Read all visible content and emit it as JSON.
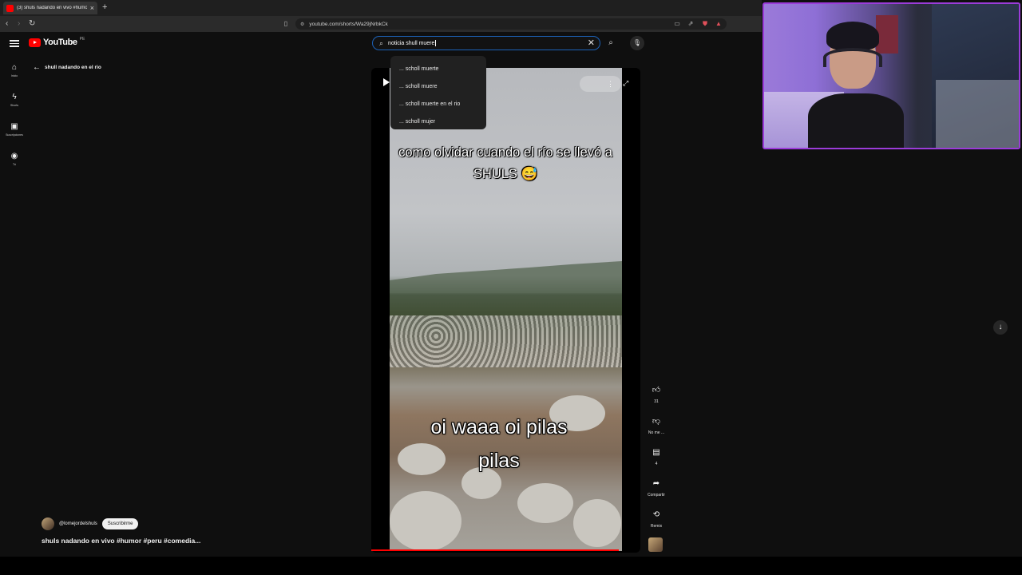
{
  "browser": {
    "tab_title": "(3) shuls nadando en vivo #humo",
    "url": "youtube.com/shorts/Wa29jNrbkCk"
  },
  "youtube": {
    "logo_text": "YouTube",
    "logo_country": "PE",
    "search": {
      "value": "noticia shull muere",
      "suggestions": [
        "... scholl muerte",
        "... scholl muere",
        "... scholl muerte en el rio",
        "... scholl mujer"
      ]
    },
    "rail": [
      {
        "icon": "home-icon",
        "label": "Inicio"
      },
      {
        "icon": "shorts-icon",
        "label": "Shorts"
      },
      {
        "icon": "subscriptions-icon",
        "label": "Suscripciones"
      },
      {
        "icon": "you-icon",
        "label": "Tú"
      }
    ],
    "back_title": "shull nadando en el rio",
    "video": {
      "caption_top": "como olvidar cuando el río se llevó a SHULS 😅",
      "caption_bottom": "oi waaa oi pilas pilas",
      "progress": 0.95
    },
    "actions": {
      "like_count": "31",
      "dislike_label": "No me ...",
      "comments_count": "4",
      "share_label": "Compartir",
      "remix_label": "Remix"
    },
    "channel": {
      "handle": "@lomejordelshuls",
      "subscribe_label": "Suscribirme"
    },
    "title": "shuls nadando en vivo  #humor #peru #comedia..."
  },
  "colors": {
    "brand_red": "#ff0000",
    "search_focus": "#1c62b9",
    "webcam_border": "#9b3cd9"
  }
}
